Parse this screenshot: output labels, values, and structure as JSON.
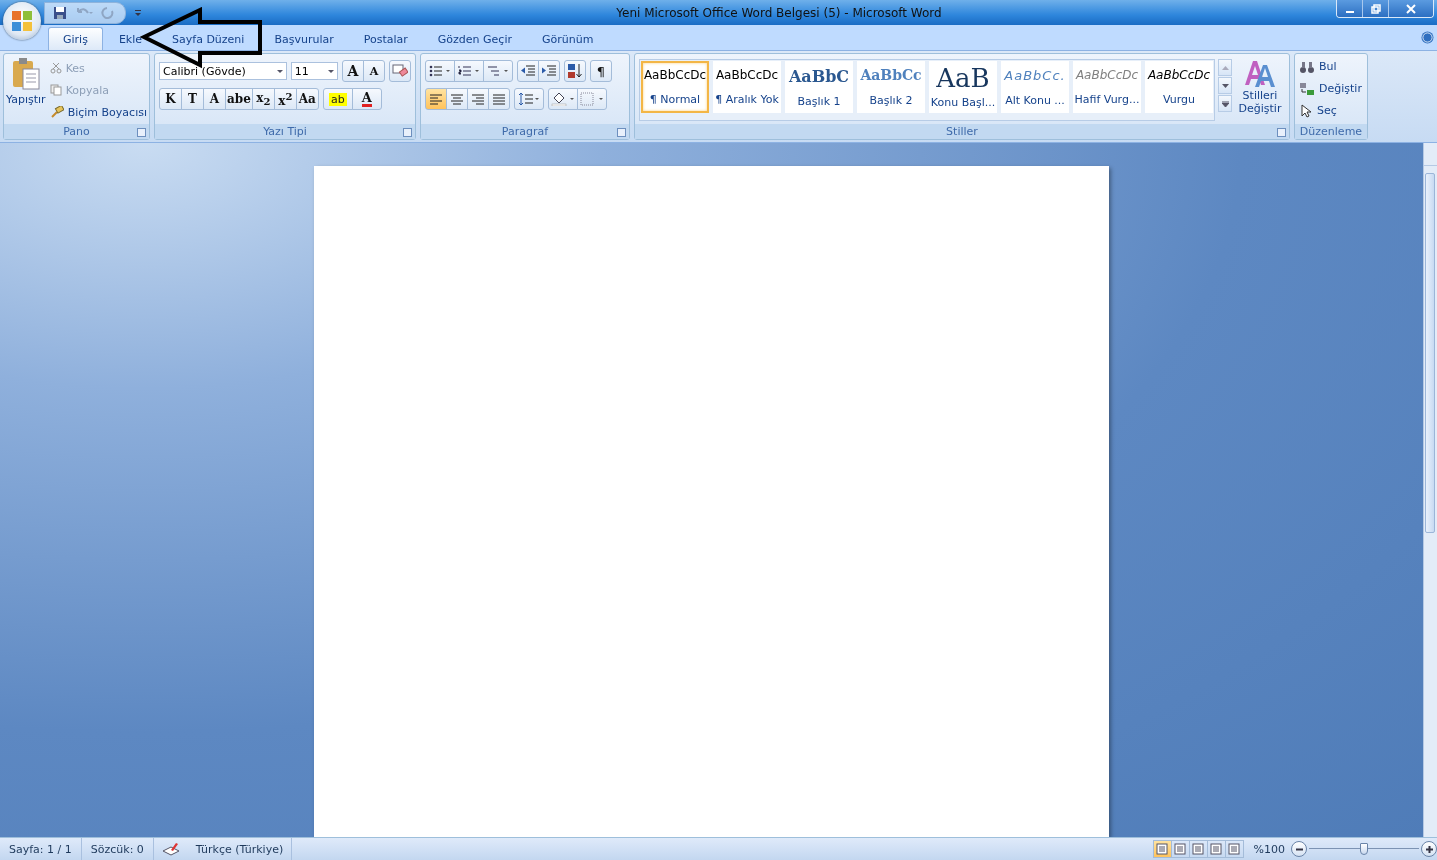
{
  "window": {
    "title": "Yeni Microsoft Office Word Belgesi (5)  -  Microsoft Word"
  },
  "tabs": [
    {
      "label": "Giriş",
      "selected": true
    },
    {
      "label": "Ekle",
      "selected": false
    },
    {
      "label": "Sayfa Düzeni",
      "selected": false
    },
    {
      "label": "Başvurular",
      "selected": false
    },
    {
      "label": "Postalar",
      "selected": false
    },
    {
      "label": "Gözden Geçir",
      "selected": false
    },
    {
      "label": "Görünüm",
      "selected": false
    }
  ],
  "clipboard": {
    "label": "Pano",
    "paste": "Yapıştır",
    "items": [
      {
        "label": "Kes",
        "disabled": true
      },
      {
        "label": "Kopyala",
        "disabled": true
      },
      {
        "label": "Biçim Boyacısı",
        "disabled": false
      }
    ]
  },
  "font": {
    "label": "Yazı Tipi",
    "name": "Calibri (Gövde)",
    "size": "11",
    "grow": "A",
    "shrink": "A",
    "buttons": [
      "K",
      "T",
      "A",
      "abe",
      "x$_{2}$",
      "x$^{2}$",
      "Aa"
    ],
    "highlight": "ab",
    "font_color_button": "A"
  },
  "paragraph": {
    "label": "Paragraf",
    "pilcrow": "¶",
    "alignments": [
      {
        "selected": true
      },
      {
        "selected": false
      },
      {
        "selected": false
      },
      {
        "selected": false
      }
    ]
  },
  "styles": {
    "label": "Stiller",
    "change": "Stilleri Değiştir",
    "items": [
      {
        "preview": "AaBbCcDc",
        "label": "¶ Normal",
        "kind": "normal",
        "selected": true
      },
      {
        "preview": "AaBbCcDc",
        "label": "¶ Aralık Yok",
        "kind": "normal",
        "selected": false
      },
      {
        "preview": "AaBbC",
        "label": "Başlık 1",
        "kind": "heading1",
        "selected": false
      },
      {
        "preview": "AaBbCc",
        "label": "Başlık 2",
        "kind": "heading2",
        "selected": false
      },
      {
        "preview": "AaB",
        "label": "Konu Başl...",
        "kind": "title",
        "selected": false
      },
      {
        "preview": "AaBbCc.",
        "label": "Alt Konu ...",
        "kind": "subtitle",
        "selected": false
      },
      {
        "preview": "AaBbCcDc",
        "label": "Hafif Vurg...",
        "kind": "subtle",
        "selected": false
      },
      {
        "preview": "AaBbCcDc",
        "label": "Vurgu",
        "kind": "emphasis",
        "selected": false
      }
    ]
  },
  "editing": {
    "label": "Düzenleme",
    "items": [
      {
        "label": "Bul",
        "kind": "find"
      },
      {
        "label": "Değiştir",
        "kind": "replace"
      },
      {
        "label": "Seç",
        "kind": "select"
      }
    ]
  },
  "status_bar": {
    "items": [
      "Sayfa: 1 / 1",
      "Sözcük: 0"
    ],
    "language": "Türkçe (Türkiye)",
    "views": [
      {
        "selected": true
      },
      {
        "selected": false
      },
      {
        "selected": false
      },
      {
        "selected": false
      },
      {
        "selected": false
      }
    ],
    "zoom": "%100",
    "zoom_slider": {
      "level": 0.5
    }
  }
}
